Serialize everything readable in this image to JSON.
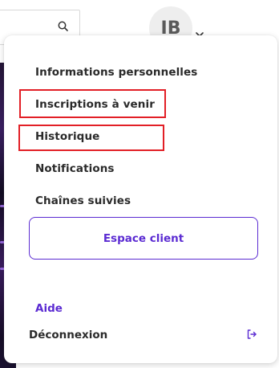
{
  "menu": {
    "items": [
      {
        "label": "Informations personnelles"
      },
      {
        "label": "Inscriptions à venir",
        "highlighted": true
      },
      {
        "label": "Historique",
        "highlighted": true
      },
      {
        "label": "Notifications"
      },
      {
        "label": "Chaînes suivies"
      }
    ],
    "client_button": "Espace client",
    "help_link": "Aide",
    "logout": "Déconnexion"
  },
  "header": {
    "avatar_initials": "IB"
  },
  "colors": {
    "accent": "#5b2bd2",
    "highlight": "#e21f26",
    "text": "#2a2a2a",
    "avatar_bg": "#eeeeee"
  },
  "icons": {
    "search": "search-icon",
    "account_menu": "chevron-down-icon",
    "logout": "logout-icon"
  }
}
